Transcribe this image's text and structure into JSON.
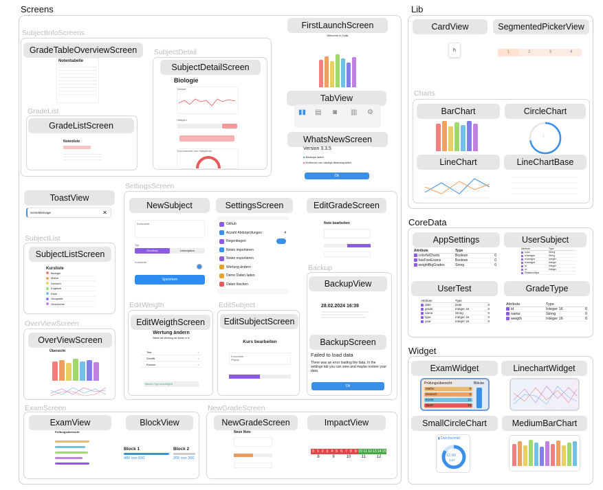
{
  "sections": {
    "screens": "Screens",
    "lib": "Lib",
    "coredata": "CoreData",
    "widget": "Widget"
  },
  "groups": {
    "subject_info": "SubjectInfoScreens",
    "subject_detail": "SubjectDetail",
    "grade_list": "GradeList",
    "settings": "SettingsScreen",
    "subject_list": "SubjectList",
    "overview": "OverViewScreen",
    "edit_weigth": "EditWeigth",
    "edit_subject": "EditSubject",
    "backup": "Backup",
    "exam": "ExamScreen",
    "new_grade": "NewGradeScreen",
    "charts": "Charts"
  },
  "pills": {
    "grade_table_overview": "GradeTableOverviewScreen",
    "subject_detail": "SubjectDetailScreen",
    "grade_list": "GradeListScreen",
    "first_launch": "FirstLaunchScreen",
    "tab_view": "TabView",
    "whats_new": "WhatsNewScreen",
    "toast_view": "ToastView",
    "new_subject": "NewSubject",
    "settings_screen": "SettingsScreen",
    "edit_grade": "EditGradeScreen",
    "subject_list": "SubjectListScreen",
    "backup_view": "BackupView",
    "overview": "OverViewScreen",
    "edit_weigth": "EditWeigthScreen",
    "edit_subject": "EditSubjectScreen",
    "backup_screen": "BackupScreen",
    "exam_view": "ExamView",
    "block_view": "BlockView",
    "new_grade": "NewGradeScreen",
    "impact_view": "ImpactView",
    "card_view": "CardView",
    "segmented_picker": "SegmentedPickerView",
    "bar_chart": "BarChart",
    "circle_chart": "CircleChart",
    "line_chart": "LineChart",
    "line_chart_base": "LineChartBase",
    "app_settings": "AppSettings",
    "user_subject": "UserSubject",
    "user_test": "UserTest",
    "grade_type": "GradeType",
    "exam_widget": "ExamWidget",
    "linechart_widget": "LinechartWidget",
    "small_circle_chart": "SmallCircleChart",
    "medium_bar_chart": "MediumBarChart"
  },
  "previews": {
    "grade_table_title": "Notentabelle",
    "subject_detail_title": "Biologie",
    "subject_detail_verlauf": "Verlauf",
    "subject_detail_halbjahr": "Halbjahr",
    "subject_detail_schnitt": "Durchschnitt des Halbjahres",
    "grade_list_title": "Notenliste",
    "first_launch_title": "Welcome to Cally",
    "whats_new_version": "Version 3.3.5",
    "whats_new_item1": "Backups laden",
    "whats_new_item2": "Entfernen von häufige Absturzquellen",
    "whats_new_ok": "Ok",
    "toast_message": "SomeMessage",
    "toast_close": "✕",
    "new_subject_kursname": "Kursname",
    "new_subject_typ": "Typ",
    "new_subject_grundkurs": "Grundkurs",
    "new_subject_lk": "Leistungskurs",
    "new_subject_kursfarbe": "Kursfarbe",
    "new_subject_save": "Speichern",
    "settings_items": [
      "Github",
      "Anzahl Abiturprüfungen",
      "Regenbogen",
      "Noten importieren",
      "Noten exportieren",
      "Wertung ändern",
      "Demo Daten laden",
      "Daten löschen"
    ],
    "settings_stepper": "4",
    "edit_grade_title": "Note bearbeiten",
    "subject_list_title": "Kursliste",
    "subject_list_items": [
      "Biologie",
      "Mathe",
      "Deutsch",
      "Englisch",
      "Ethik",
      "Geografie",
      "Geschichte"
    ],
    "backup_title": "28.02.2024 16:39",
    "overview_title": "Übersicht",
    "edit_weigth_title": "Wertung ändern",
    "edit_weigth_sub": "Wähle die Wertung der Noten in %",
    "edit_weigth_rows": [
      "Test",
      "Schriftl.",
      "Klausur"
    ],
    "edit_weigth_btn": "Neuen Typ hinzufügen",
    "edit_subject_title": "Kurs bearbeiten",
    "edit_subject_kursname": "Kursname",
    "edit_subject_value": "Physik",
    "backup_error_title": "Failed to load data",
    "backup_error_text": "There was an error loading the data. In the settings tab you can view and maybe restore your data",
    "backup_ok": "Ok",
    "exam_title": "Prüfungsübersicht",
    "block1_label": "Block 1",
    "block1_value": "480 von 600",
    "block2_label": "Block 2",
    "block2_value": "205 von 300",
    "new_grade_title": "Neue Note",
    "impact_row1": [
      "0",
      "1",
      "2",
      "3",
      "4",
      "5",
      "6",
      "7",
      "8",
      "9",
      "10",
      "11",
      "12",
      "13",
      "14",
      "15"
    ],
    "impact_row2": [
      "8",
      "9",
      "10",
      "11",
      "12"
    ],
    "card_letter": "h",
    "segments": [
      "1",
      "2",
      "3",
      "4"
    ],
    "circle_center": ":",
    "exam_widget_title": "Prüfungsübersicht",
    "exam_widget_block": "Blöcke",
    "exam_widget_rows": [
      {
        "name": "Mathe",
        "value": "9"
      },
      {
        "name": "Deutsch",
        "value": "8"
      },
      {
        "name": "Kunst",
        "value": "11"
      },
      {
        "name": "Sport",
        "value": "15"
      }
    ],
    "small_circle_title": "Durchschnitt",
    "small_circle_value": "12.00",
    "small_circle_sub": "1,67"
  },
  "entities": {
    "app_settings": {
      "header": [
        "Attribute",
        "Type"
      ],
      "rows": [
        [
          "colorfulCharts",
          "Boolean",
          "0"
        ],
        [
          "hasFiveExams",
          "Boolean",
          "0"
        ],
        [
          "weightBigGrades",
          "String",
          "0"
        ]
      ]
    },
    "user_subject": {
      "header": [
        "Attribute",
        "Type"
      ],
      "rows": [
        [
          "color",
          "String"
        ],
        [
          "examtype",
          "String"
        ],
        [
          "examtype",
          "Integer"
        ],
        [
          "examtype",
          "Integer"
        ],
        [
          "id",
          "Integer"
        ],
        [
          "id",
          "Integer"
        ],
        [
          "Relationships",
          ""
        ]
      ]
    },
    "user_test": {
      "header": [
        "Attribute",
        "Type"
      ],
      "rows": [
        [
          "date",
          "Date",
          "0"
        ],
        [
          "grade",
          "Integer 16",
          "0"
        ],
        [
          "name",
          "String",
          "0"
        ],
        [
          "type",
          "Integer 16",
          "0"
        ],
        [
          "year",
          "Integer 16",
          "0"
        ]
      ]
    },
    "grade_type": {
      "header": [
        "Attribute",
        "Type"
      ],
      "rows": [
        [
          "id",
          "Integer 16",
          "0"
        ],
        [
          "name",
          "String",
          "0"
        ],
        [
          "weigth",
          "Integer 16",
          "0"
        ]
      ]
    }
  },
  "colors": {
    "rainbow": [
      "#f08080",
      "#f0a060",
      "#e8d060",
      "#a0d870",
      "#70c0e8",
      "#8080e8",
      "#c080e0"
    ],
    "accent": "#3a8fe8",
    "purple": "#8a5be0",
    "red": "#e85a5a"
  }
}
